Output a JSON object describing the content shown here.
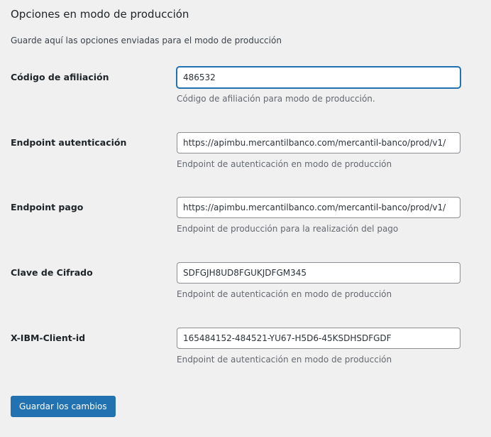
{
  "section": {
    "title": "Opciones en modo de producción",
    "description": "Guarde aquí las opciones enviadas para el modo de producción"
  },
  "fields": [
    {
      "label": "Código de afiliación",
      "value": "486532",
      "help": "Código de afiliación para modo de producción.",
      "focused": true
    },
    {
      "label": "Endpoint autenticación",
      "value": "https://apimbu.mercantilbanco.com/mercantil-banco/prod/v1/",
      "help": "Endpoint de autenticación en modo de producción",
      "focused": false
    },
    {
      "label": "Endpoint pago",
      "value": "https://apimbu.mercantilbanco.com/mercantil-banco/prod/v1/",
      "help": "Endpoint de producción para la realización del pago",
      "focused": false
    },
    {
      "label": "Clave de Cifrado",
      "value": "SDFGJH8UD8FGUKJDFGM345",
      "help": "Endpoint de autenticación en modo de producción",
      "focused": false
    },
    {
      "label": "X-IBM-Client-id",
      "value": "165484152-484521-YU67-H5D6-45KSDHSDFGDF",
      "help": "Endpoint de autenticación en modo de producción",
      "focused": false
    }
  ],
  "actions": {
    "save_label": "Guardar los cambios"
  },
  "colors": {
    "accent": "#2271b1",
    "background": "#f0f0f1",
    "help_text": "#646970"
  }
}
